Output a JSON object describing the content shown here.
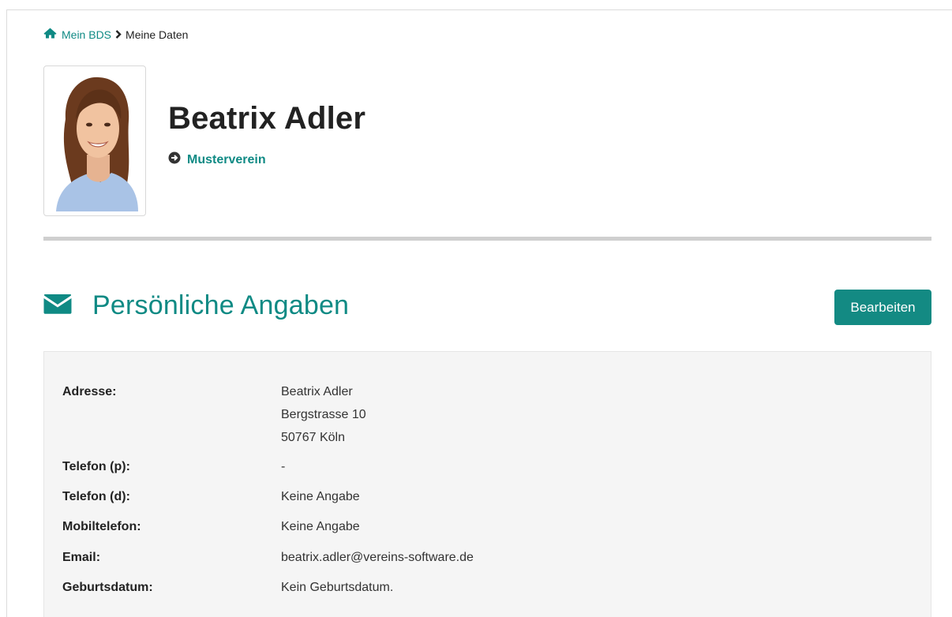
{
  "breadcrumb": {
    "home": "Mein BDS",
    "current": "Meine Daten"
  },
  "profile": {
    "name": "Beatrix Adler",
    "club": "Musterverein"
  },
  "section": {
    "title": "Persönliche Angaben",
    "edit_label": "Bearbeiten"
  },
  "details": {
    "address_label": "Adresse:",
    "address_line1": "Beatrix Adler",
    "address_line2": "Bergstrasse 10",
    "address_line3": "50767 Köln",
    "phone_private_label": "Telefon (p):",
    "phone_private_value": "-",
    "phone_work_label": "Telefon (d):",
    "phone_work_value": "Keine Angabe",
    "mobile_label": "Mobiltelefon:",
    "mobile_value": "Keine Angabe",
    "email_label": "Email:",
    "email_value": "beatrix.adler@vereins-software.de",
    "birthdate_label": "Geburtsdatum:",
    "birthdate_value": "Kein Geburtsdatum."
  },
  "colors": {
    "accent": "#0f8a84",
    "button": "#138a83",
    "panel": "#f5f5f5",
    "divider": "#cfcfcf"
  },
  "icons": {
    "home": "home-icon",
    "separator": "chevron-right-icon",
    "club": "circle-arrow-right-icon",
    "section": "envelope-icon"
  }
}
